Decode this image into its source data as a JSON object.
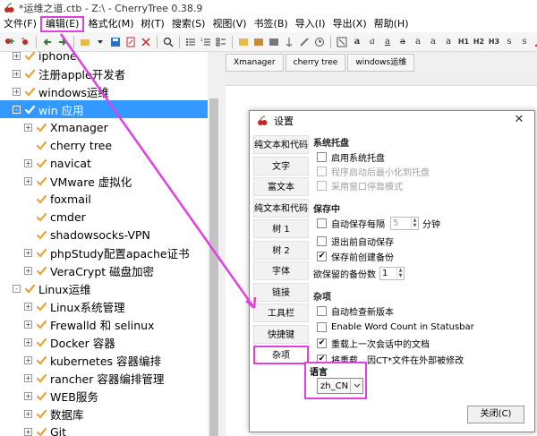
{
  "window": {
    "title": "*运维之道.ctb - Z:\\ - CherryTree 0.38.9"
  },
  "menu": [
    {
      "label": "文件(F)",
      "highlight": false
    },
    {
      "label": "编辑(E)",
      "highlight": true
    },
    {
      "label": "格式化(M)",
      "highlight": false
    },
    {
      "label": "树(T)",
      "highlight": false
    },
    {
      "label": "搜索(S)",
      "highlight": false
    },
    {
      "label": "视图(V)",
      "highlight": false
    },
    {
      "label": "书签(B)",
      "highlight": false
    },
    {
      "label": "导入(I)",
      "highlight": false
    },
    {
      "label": "导出(X)",
      "highlight": false
    },
    {
      "label": "帮助(H)",
      "highlight": false
    }
  ],
  "toolbar": {
    "right_glyphs": [
      "a",
      "a",
      "a",
      "a",
      "a",
      "a",
      "a",
      "H1",
      "H2",
      "H3",
      "s",
      "s"
    ]
  },
  "tree": [
    {
      "label": "iphone",
      "level": 0,
      "expander": "+",
      "selected": false
    },
    {
      "label": "注册apple开发者",
      "level": 0,
      "expander": "+",
      "selected": false
    },
    {
      "label": "windows运维",
      "level": 0,
      "expander": "+",
      "selected": false
    },
    {
      "label": "win 应用",
      "level": 0,
      "expander": "-",
      "selected": true
    },
    {
      "label": "Xmanager",
      "level": 1,
      "expander": "+",
      "selected": false
    },
    {
      "label": "cherry tree",
      "level": 1,
      "expander": "",
      "selected": false
    },
    {
      "label": "navicat",
      "level": 1,
      "expander": "+",
      "selected": false
    },
    {
      "label": "VMware 虚拟化",
      "level": 1,
      "expander": "+",
      "selected": false
    },
    {
      "label": "foxmail",
      "level": 1,
      "expander": "",
      "selected": false
    },
    {
      "label": "cmder",
      "level": 1,
      "expander": "",
      "selected": false
    },
    {
      "label": "shadowsocks-VPN",
      "level": 1,
      "expander": "",
      "selected": false
    },
    {
      "label": "phpStudy配置apache证书",
      "level": 1,
      "expander": "+",
      "selected": false
    },
    {
      "label": "VeraCrypt 磁盘加密",
      "level": 1,
      "expander": "+",
      "selected": false
    },
    {
      "label": "Linux运维",
      "level": 0,
      "expander": "-",
      "selected": false
    },
    {
      "label": "Linux系统管理",
      "level": 1,
      "expander": "+",
      "selected": false
    },
    {
      "label": "Frewalld 和 selinux",
      "level": 1,
      "expander": "+",
      "selected": false
    },
    {
      "label": "Docker 容器",
      "level": 1,
      "expander": "+",
      "selected": false
    },
    {
      "label": "kubernetes 容器编排",
      "level": 1,
      "expander": "+",
      "selected": false
    },
    {
      "label": "rancher 容器编排管理",
      "level": 1,
      "expander": "+",
      "selected": false
    },
    {
      "label": "WEB服务",
      "level": 1,
      "expander": "+",
      "selected": false
    },
    {
      "label": "数据库",
      "level": 1,
      "expander": "+",
      "selected": false
    },
    {
      "label": "Git",
      "level": 1,
      "expander": "+",
      "selected": false
    }
  ],
  "tabs": [
    "Xmanager",
    "cherry tree",
    "windows运维"
  ],
  "dialog": {
    "title": "设置",
    "close_glyph": "✕",
    "nav": [
      "纯文本和代码",
      "文字",
      "富文本",
      "纯文本和代码",
      "树 1",
      "树 2",
      "字体",
      "链接",
      "工具栏",
      "快捷键",
      "杂项"
    ],
    "active_nav_index": 10,
    "tray": {
      "title": "系统托盘",
      "enable": {
        "label": "启用系统托盘",
        "checked": false,
        "disabled": false
      },
      "minimize": {
        "label": "程序启动后最小化到托盘",
        "checked": false,
        "disabled": true
      },
      "legacy": {
        "label": "采用窗口停靠模式",
        "checked": false,
        "disabled": true
      }
    },
    "save": {
      "title": "保存中",
      "autosave_label": "自动保存每隔",
      "autosave_value": "5",
      "autosave_unit": "分钟",
      "autosave_checked": false,
      "exit_save": {
        "label": "退出前自动保存",
        "checked": false
      },
      "backup": {
        "label": "保存前创建备份",
        "checked": true
      },
      "backup_count_label": "欲保留的备份数",
      "backup_count_value": "1"
    },
    "misc": {
      "title": "杂项",
      "check_version": {
        "label": "自动检查新版本",
        "checked": false
      },
      "word_count": {
        "label": "Enable Word Count in Statusbar",
        "checked": false
      },
      "reload_last": {
        "label": "重载上一次会话中的文档",
        "checked": true
      },
      "reload_modified": {
        "label": "将重载，因CT*文件在外部被修改",
        "checked": true
      }
    },
    "language": {
      "title": "语言",
      "value": "zh_CN"
    },
    "close_button": "关闭(C)"
  },
  "colors": {
    "highlight": "#e040e0",
    "selection": "#3399ff",
    "bullet": "#e8a33a",
    "icon_blue": "#2a6fc9"
  }
}
